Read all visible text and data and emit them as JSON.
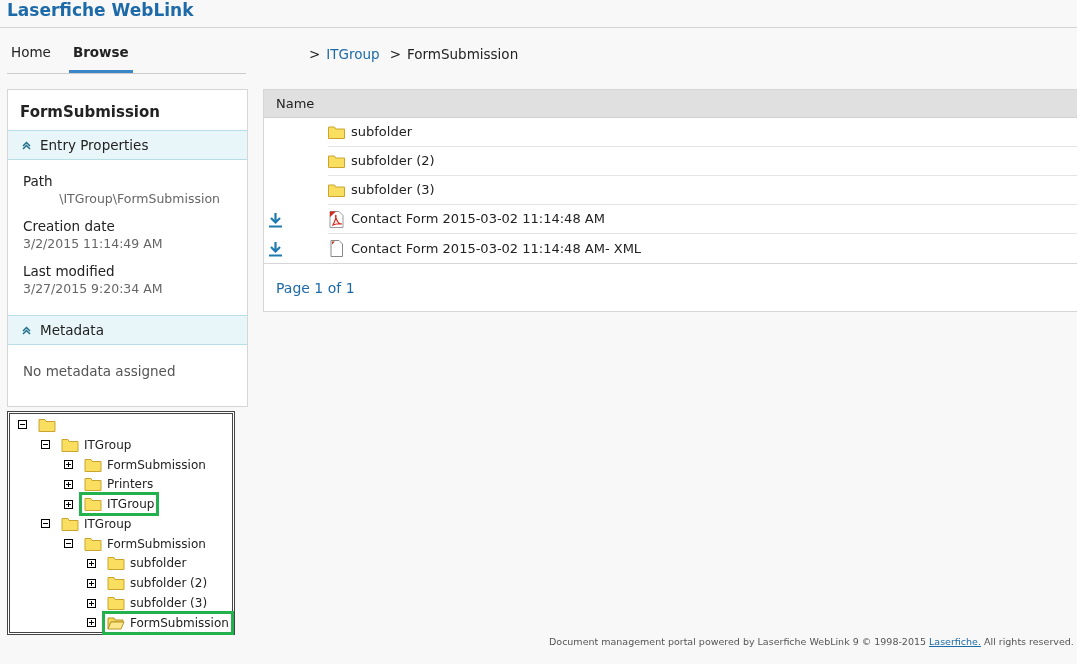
{
  "app_title": "Laserfiche WebLink",
  "tabs": [
    {
      "label": "Home",
      "selected": false
    },
    {
      "label": "Browse",
      "selected": true
    }
  ],
  "breadcrumb": [
    {
      "separator": ">",
      "label": "ITGroup",
      "kind": "link"
    },
    {
      "separator": ">",
      "label": "FormSubmission",
      "kind": "current"
    }
  ],
  "entry_panel": {
    "title": "FormSubmission",
    "sections": [
      {
        "title": "Entry Properties",
        "expanded": true,
        "properties": [
          {
            "label": "Path",
            "value": "\\ITGroup\\FormSubmission"
          },
          {
            "label": "Creation date",
            "value": "3/2/2015 11:14:49 AM"
          },
          {
            "label": "Last modified",
            "value": "3/27/2015 9:20:34 AM"
          }
        ]
      },
      {
        "title": "Metadata",
        "expanded": true,
        "message": "No metadata assigned"
      }
    ]
  },
  "tree": [
    {
      "expanded": true,
      "highlighted": false,
      "folder_open": false,
      "children": [
        {
          "label": "ITGroup",
          "expanded": true,
          "highlighted": false,
          "folder_open": false,
          "children": [
            {
              "label": "FormSubmission",
              "expanded": false,
              "highlighted": false,
              "folder_open": false
            },
            {
              "label": "Printers",
              "expanded": false,
              "highlighted": false,
              "folder_open": false
            },
            {
              "label": "ITGroup",
              "expanded": false,
              "highlighted": true,
              "folder_open": false
            }
          ]
        },
        {
          "label": "ITGroup",
          "expanded": true,
          "highlighted": false,
          "folder_open": false,
          "children": [
            {
              "label": "FormSubmission",
              "expanded": true,
              "highlighted": false,
              "folder_open": false,
              "children": [
                {
                  "label": "subfolder",
                  "expanded": false,
                  "highlighted": false,
                  "folder_open": false
                },
                {
                  "label": "subfolder (2)",
                  "expanded": false,
                  "highlighted": false,
                  "folder_open": false
                },
                {
                  "label": "subfolder (3)",
                  "expanded": false,
                  "highlighted": false,
                  "folder_open": false
                },
                {
                  "label": "FormSubmission",
                  "expanded": false,
                  "highlighted": true,
                  "folder_open": true
                }
              ]
            }
          ]
        }
      ]
    }
  ],
  "table": {
    "columns": [
      "Name"
    ],
    "rows": [
      {
        "kind": "folder",
        "name": "subfolder",
        "downloadable": false
      },
      {
        "kind": "folder",
        "name": "subfolder (2)",
        "downloadable": false
      },
      {
        "kind": "folder",
        "name": "subfolder (3)",
        "downloadable": false
      },
      {
        "kind": "pdf",
        "name": "Contact Form 2015-03-02 11:14:48 AM",
        "downloadable": true
      },
      {
        "kind": "file",
        "name": "Contact Form 2015-03-02 11:14:48 AM- XML",
        "downloadable": true
      }
    ],
    "pager": "Page 1 of 1"
  },
  "footer": {
    "before": "Document management portal powered by Laserfiche WebLink 9 © 1998-2015 ",
    "link": "Laserfiche.",
    "after": " All rights reserved."
  }
}
